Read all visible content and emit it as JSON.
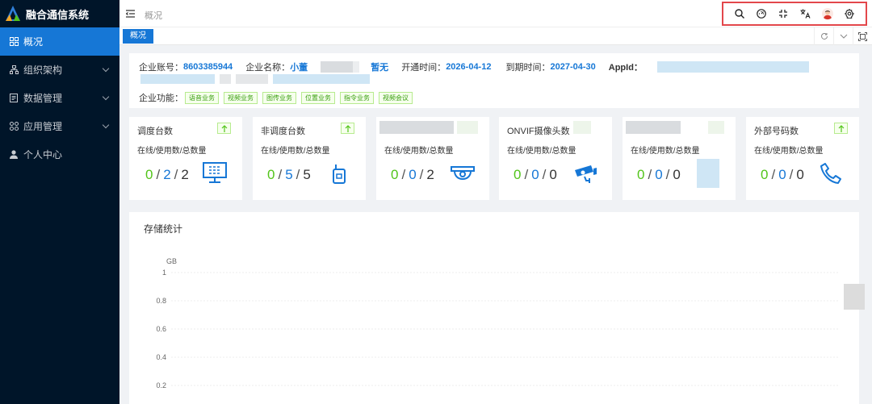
{
  "app": {
    "title": "融合通信系统"
  },
  "sidebar": {
    "items": [
      {
        "label": "概况",
        "icon": "grid-icon",
        "active": true
      },
      {
        "label": "组织架构",
        "icon": "org-icon"
      },
      {
        "label": "数据管理",
        "icon": "file-icon"
      },
      {
        "label": "应用管理",
        "icon": "apps-icon"
      },
      {
        "label": "个人中心",
        "icon": "user-icon"
      }
    ]
  },
  "header": {
    "breadcrumb": "概况",
    "tools": [
      "search-icon",
      "dashboard-icon",
      "fullscreen-icon",
      "translate-icon",
      "avatar",
      "settings-icon"
    ]
  },
  "tabs": {
    "active_label": "概况"
  },
  "company": {
    "account_label": "企业账号：",
    "account_value": "8603385944",
    "name_label": "企业名称：",
    "name_value": "小董",
    "status_value": "暂无",
    "open_label": "开通时间：",
    "open_value": "2026-04-12",
    "expire_label": "到期时间：",
    "expire_value": "2027-04-30",
    "appid_label": "AppId：",
    "features_label": "企业功能：",
    "features": [
      "语音业务",
      "视频业务",
      "图传业务",
      "位置业务",
      "指令业务",
      "视频会议"
    ]
  },
  "cards": [
    {
      "title": "调度台数",
      "sub": "在线/使用数/总数量",
      "online": "0",
      "used": "2",
      "total": "2",
      "icon": "monitor-icon"
    },
    {
      "title": "非调度台数",
      "sub": "在线/使用数/总数量",
      "online": "0",
      "used": "5",
      "total": "5",
      "icon": "walkie-talkie-icon"
    },
    {
      "title": "",
      "sub": "在线/使用数/总数量",
      "online": "0",
      "used": "0",
      "total": "2",
      "icon": "dome-camera-icon"
    },
    {
      "title": "ONVIF摄像头数",
      "sub": "在线/使用数/总数量",
      "online": "0",
      "used": "0",
      "total": "0",
      "icon": "cctv-camera-icon"
    },
    {
      "title": "",
      "sub": "在线/使用数/总数量",
      "online": "0",
      "used": "0",
      "total": "0",
      "icon": "blurred-icon"
    },
    {
      "title": "外部号码数",
      "sub": "在线/使用数/总数量",
      "online": "0",
      "used": "0",
      "total": "0",
      "icon": "phone-icon"
    }
  ],
  "storage": {
    "title": "存储统计",
    "chart_data": {
      "type": "line",
      "ylabel": "GB",
      "y_ticks": [
        "1",
        "0.8",
        "0.6",
        "0.4",
        "0.2"
      ],
      "ylim": [
        0,
        1
      ],
      "grid": true,
      "series": []
    }
  },
  "colors": {
    "primary": "#1677d6",
    "sidebar": "#001529",
    "online": "#52c41a",
    "highlight_border": "#e3474b"
  }
}
